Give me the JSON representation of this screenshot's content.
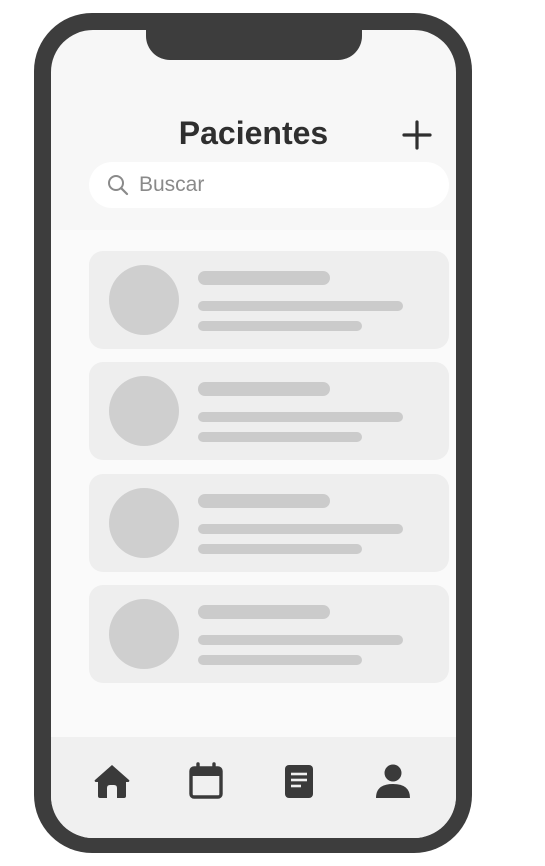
{
  "header": {
    "title": "Pacientes",
    "add_icon": "plus-icon"
  },
  "search": {
    "placeholder": "Buscar",
    "value": "",
    "icon": "search-icon"
  },
  "patients": [
    {
      "avatar": "avatar-placeholder"
    },
    {
      "avatar": "avatar-placeholder"
    },
    {
      "avatar": "avatar-placeholder"
    },
    {
      "avatar": "avatar-placeholder"
    }
  ],
  "tabbar": {
    "items": [
      {
        "icon": "home-icon"
      },
      {
        "icon": "calendar-icon"
      },
      {
        "icon": "document-icon"
      },
      {
        "icon": "user-icon"
      }
    ]
  },
  "colors": {
    "frame": "#3d3d3d",
    "screen": "#f7f7f7",
    "card": "#eeeeee",
    "placeholder": "#cbcbcb",
    "icon": "#3a3a3a"
  }
}
